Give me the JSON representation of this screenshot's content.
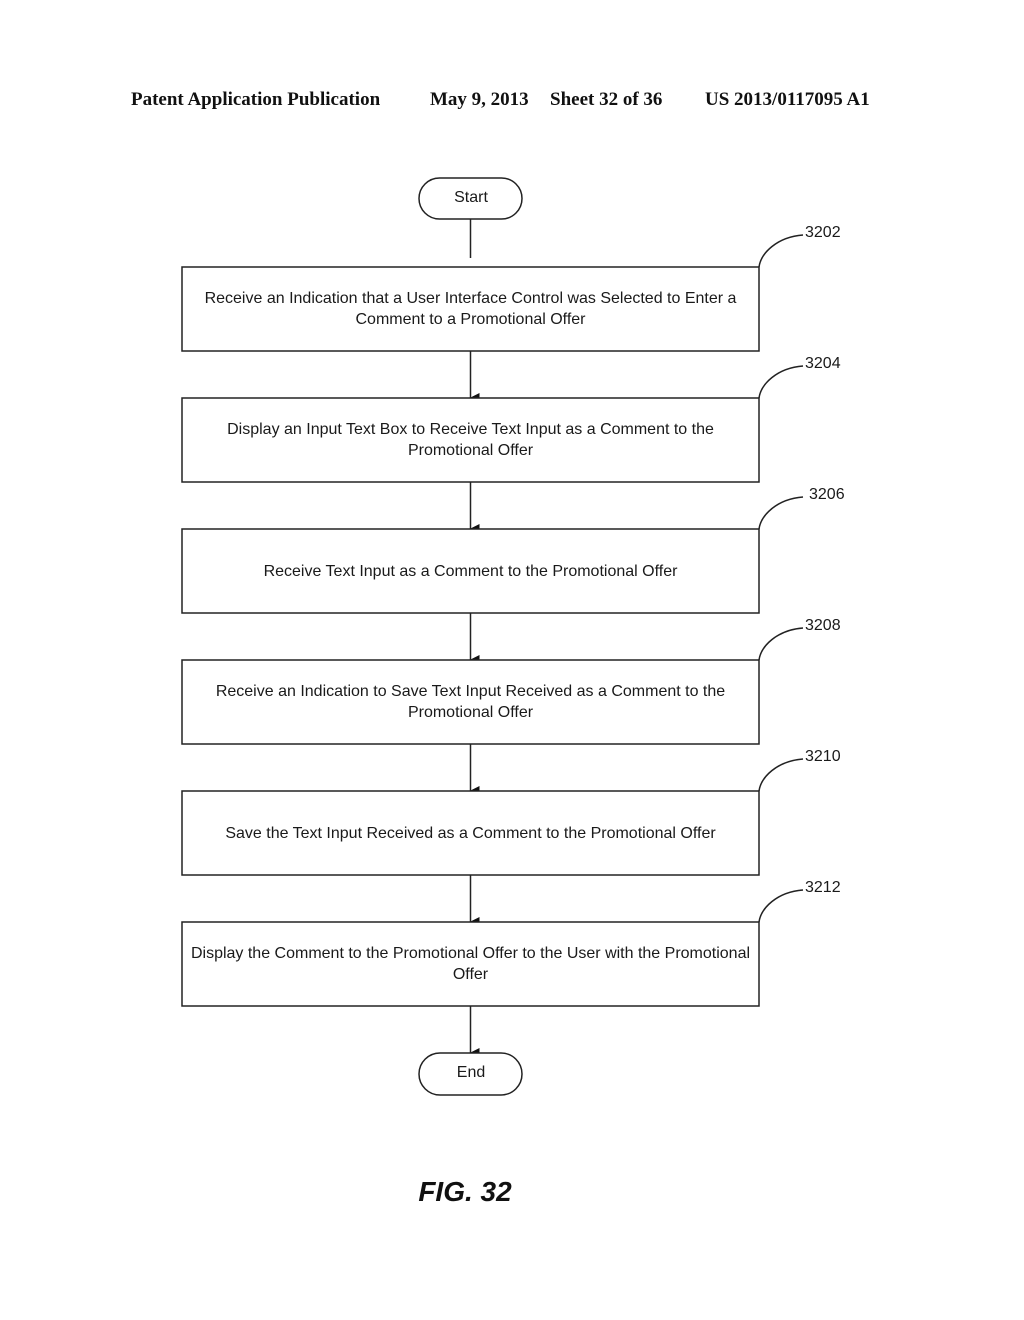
{
  "header": {
    "publication": "Patent Application Publication",
    "date": "May 9, 2013",
    "sheet": "Sheet 32 of 36",
    "number": "US 2013/0117095 A1"
  },
  "flowchart": {
    "start_label": "Start",
    "end_label": "End",
    "steps": [
      {
        "ref": "3202",
        "text": "Receive an Indication that a User Interface Control was Selected to Enter a Comment to a Promotional Offer"
      },
      {
        "ref": "3204",
        "text": "Display an Input Text Box to Receive Text Input as a Comment to the Promotional Offer"
      },
      {
        "ref": "3206",
        "text": "Receive Text Input as a Comment to the Promotional Offer"
      },
      {
        "ref": "3208",
        "text": "Receive an Indication to Save Text Input Received as a Comment to the Promotional Offer"
      },
      {
        "ref": "3210",
        "text": "Save the Text Input Received as a Comment to the Promotional Offer"
      },
      {
        "ref": "3212",
        "text": "Display the Comment to the Promotional Offer to the User with the Promotional Offer"
      }
    ]
  },
  "figure_label": "FIG. 32"
}
